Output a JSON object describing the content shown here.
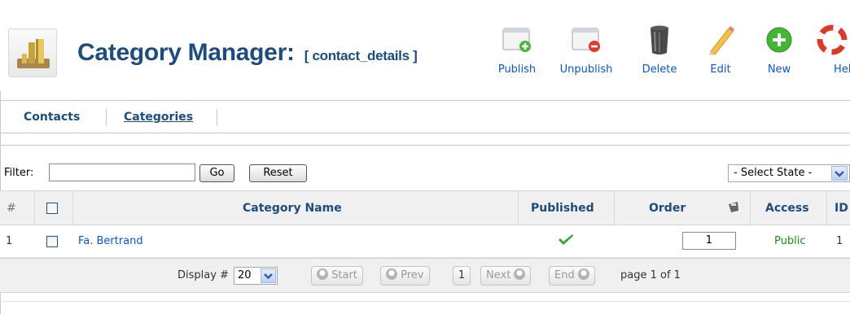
{
  "header": {
    "title": "Category Manager:",
    "subtitle": "[ contact_details ]"
  },
  "toolbar": {
    "publish": "Publish",
    "unpublish": "Unpublish",
    "delete": "Delete",
    "edit": "Edit",
    "new": "New",
    "help": "Help"
  },
  "submenu": {
    "contacts": "Contacts",
    "categories": "Categories"
  },
  "filter": {
    "label": "Filter:",
    "value": "",
    "go": "Go",
    "reset": "Reset",
    "state_select": "- Select State -"
  },
  "table": {
    "headers": {
      "num": "#",
      "category_name": "Category Name",
      "published": "Published",
      "order": "Order",
      "access": "Access",
      "id": "ID"
    },
    "rows": [
      {
        "num": "1",
        "name": "Fa. Bertrand",
        "published": true,
        "order": "1",
        "access": "Public",
        "id": "1"
      }
    ]
  },
  "pagination": {
    "display_label": "Display #",
    "display_value": "20",
    "start": "Start",
    "prev": "Prev",
    "page": "1",
    "next": "Next",
    "end": "End",
    "page_info": "page 1 of 1"
  },
  "colors": {
    "title": "#1d4c7d",
    "link": "#0b55c4",
    "access": "#1a8c1a"
  }
}
